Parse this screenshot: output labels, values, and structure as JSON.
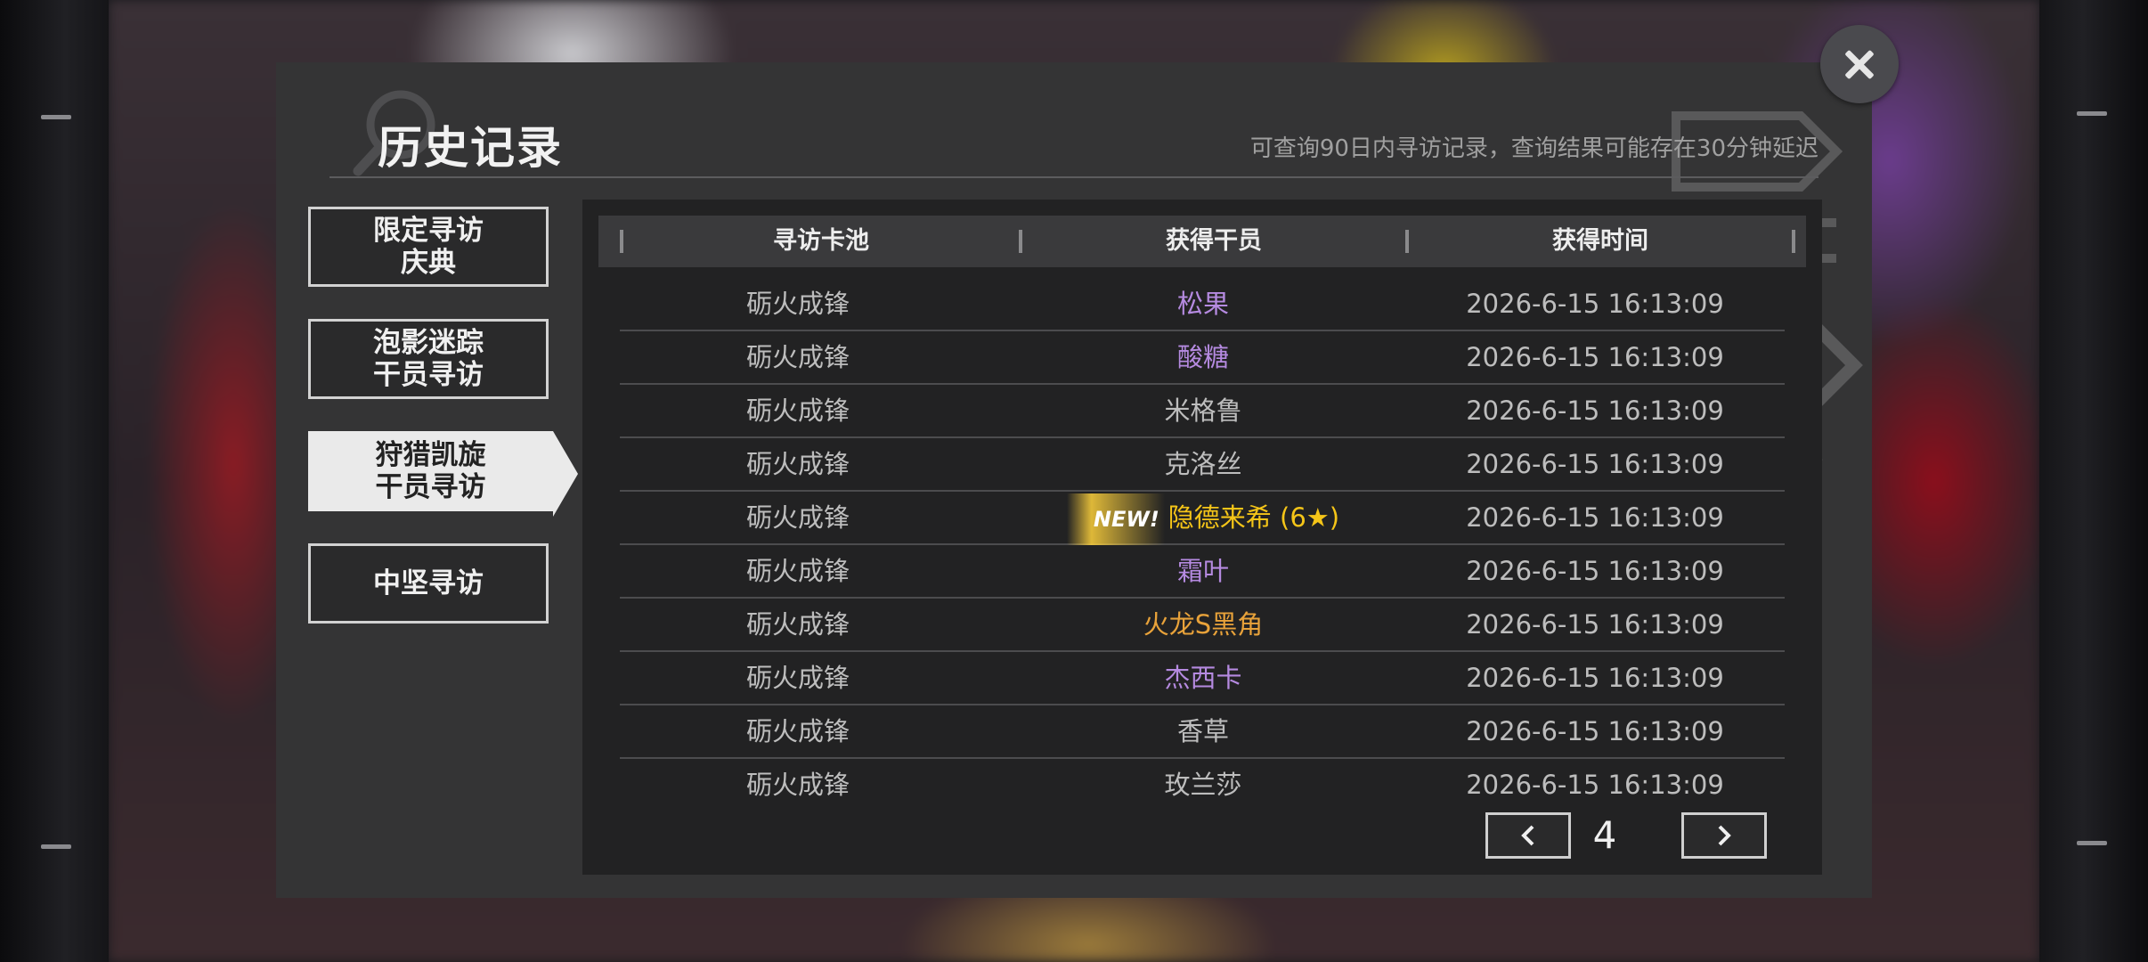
{
  "dialog": {
    "title": "历史记录",
    "subtitle": "可查询90日内寻访记录，查询结果可能存在30分钟延迟"
  },
  "tabs": [
    {
      "label": "限定寻访\n庆典",
      "active": false
    },
    {
      "label": "泡影迷踪\n干员寻访",
      "active": false
    },
    {
      "label": "狩猎凯旋\n干员寻访",
      "active": true
    },
    {
      "label": "中坚寻访",
      "active": false
    }
  ],
  "table": {
    "headers": [
      "寻访卡池",
      "获得干员",
      "获得时间"
    ],
    "rows": [
      {
        "pool": "砺火成锋",
        "operator": "松果",
        "time": "2026-6-15 16:13:09",
        "rarity_color": "#b58ae0"
      },
      {
        "pool": "砺火成锋",
        "operator": "酸糖",
        "time": "2026-6-15 16:13:09",
        "rarity_color": "#b58ae0"
      },
      {
        "pool": "砺火成锋",
        "operator": "米格鲁",
        "time": "2026-6-15 16:13:09",
        "rarity_color": "#bdbdbd"
      },
      {
        "pool": "砺火成锋",
        "operator": "克洛丝",
        "time": "2026-6-15 16:13:09",
        "rarity_color": "#bdbdbd"
      },
      {
        "pool": "砺火成锋",
        "operator": "隐德来希 (6★)",
        "time": "2026-6-15 16:13:09",
        "rarity_color": "#f5c518",
        "new": "NEW!"
      },
      {
        "pool": "砺火成锋",
        "operator": "霜叶",
        "time": "2026-6-15 16:13:09",
        "rarity_color": "#b58ae0"
      },
      {
        "pool": "砺火成锋",
        "operator": "火龙S黑角",
        "time": "2026-6-15 16:13:09",
        "rarity_color": "#e8a23a"
      },
      {
        "pool": "砺火成锋",
        "operator": "杰西卡",
        "time": "2026-6-15 16:13:09",
        "rarity_color": "#b58ae0"
      },
      {
        "pool": "砺火成锋",
        "operator": "香草",
        "time": "2026-6-15 16:13:09",
        "rarity_color": "#bdbdbd"
      },
      {
        "pool": "砺火成锋",
        "operator": "玫兰莎",
        "time": "2026-6-15 16:13:09",
        "rarity_color": "#bdbdbd"
      }
    ]
  },
  "pagination": {
    "current_page": "4",
    "prev_icon": "chevron-left-icon",
    "next_icon": "chevron-right-icon"
  },
  "icons": {
    "close": "close-icon",
    "decoration": "magnifier-icon"
  }
}
